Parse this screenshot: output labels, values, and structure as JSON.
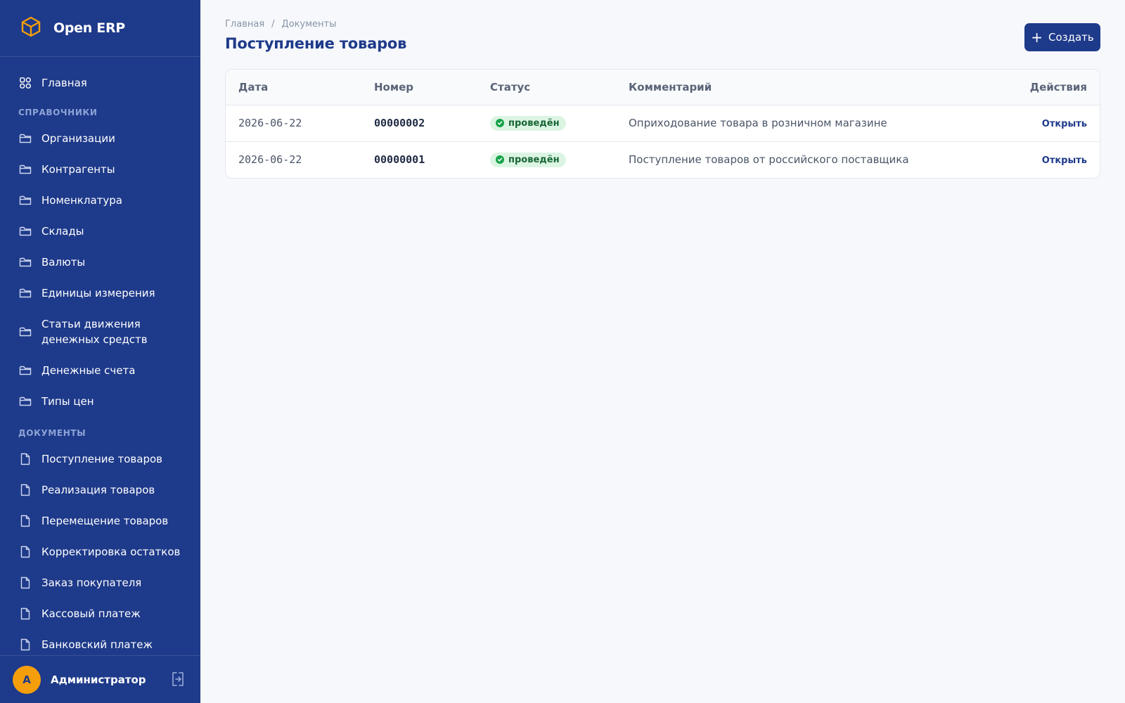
{
  "app": {
    "name": "Open ERP"
  },
  "sidebar": {
    "home": {
      "label": "Главная",
      "icon": "grid-icon"
    },
    "sections": [
      {
        "title": "СПРАВОЧНИКИ",
        "items": [
          {
            "label": "Организации",
            "icon": "folder-icon"
          },
          {
            "label": "Контрагенты",
            "icon": "folder-icon"
          },
          {
            "label": "Номенклатура",
            "icon": "folder-icon"
          },
          {
            "label": "Склады",
            "icon": "folder-icon"
          },
          {
            "label": "Валюты",
            "icon": "folder-icon"
          },
          {
            "label": "Единицы измерения",
            "icon": "folder-icon"
          },
          {
            "label_line1": "Статьи движения",
            "label_line2": "денежных средств",
            "icon": "folder-icon"
          },
          {
            "label": "Денежные счета",
            "icon": "folder-icon"
          },
          {
            "label": "Типы цен",
            "icon": "folder-icon"
          }
        ]
      },
      {
        "title": "ДОКУМЕНТЫ",
        "items": [
          {
            "label": "Поступление товаров",
            "icon": "document-icon"
          },
          {
            "label": "Реализация товаров",
            "icon": "document-icon"
          },
          {
            "label": "Перемещение товаров",
            "icon": "document-icon"
          },
          {
            "label": "Корректировка остатков",
            "icon": "document-icon"
          },
          {
            "label": "Заказ покупателя",
            "icon": "document-icon"
          },
          {
            "label": "Кассовый платеж",
            "icon": "document-icon"
          },
          {
            "label": "Банковский платеж",
            "icon": "document-icon"
          }
        ]
      }
    ]
  },
  "user": {
    "initial": "А",
    "name": "Администратор"
  },
  "breadcrumb": {
    "home": "Главная",
    "separator": "/",
    "current": "Документы"
  },
  "page": {
    "title": "Поступление товаров",
    "create_label": "Создать"
  },
  "table": {
    "columns": {
      "date": "Дата",
      "number": "Номер",
      "status": "Статус",
      "comment": "Комментарий",
      "actions": "Действия"
    },
    "rows": [
      {
        "date": "2026-06-22",
        "number": "00000002",
        "status": "проведён",
        "comment": "Оприходование товара в розничном магазине",
        "action": "Открыть"
      },
      {
        "date": "2026-06-22",
        "number": "00000001",
        "status": "проведён",
        "comment": "Поступление товаров от российского поставщика",
        "action": "Открыть"
      }
    ]
  },
  "colors": {
    "sidebar": "#1e3a8a",
    "accent": "#f59e0b",
    "status_ok": "#16a34a"
  }
}
